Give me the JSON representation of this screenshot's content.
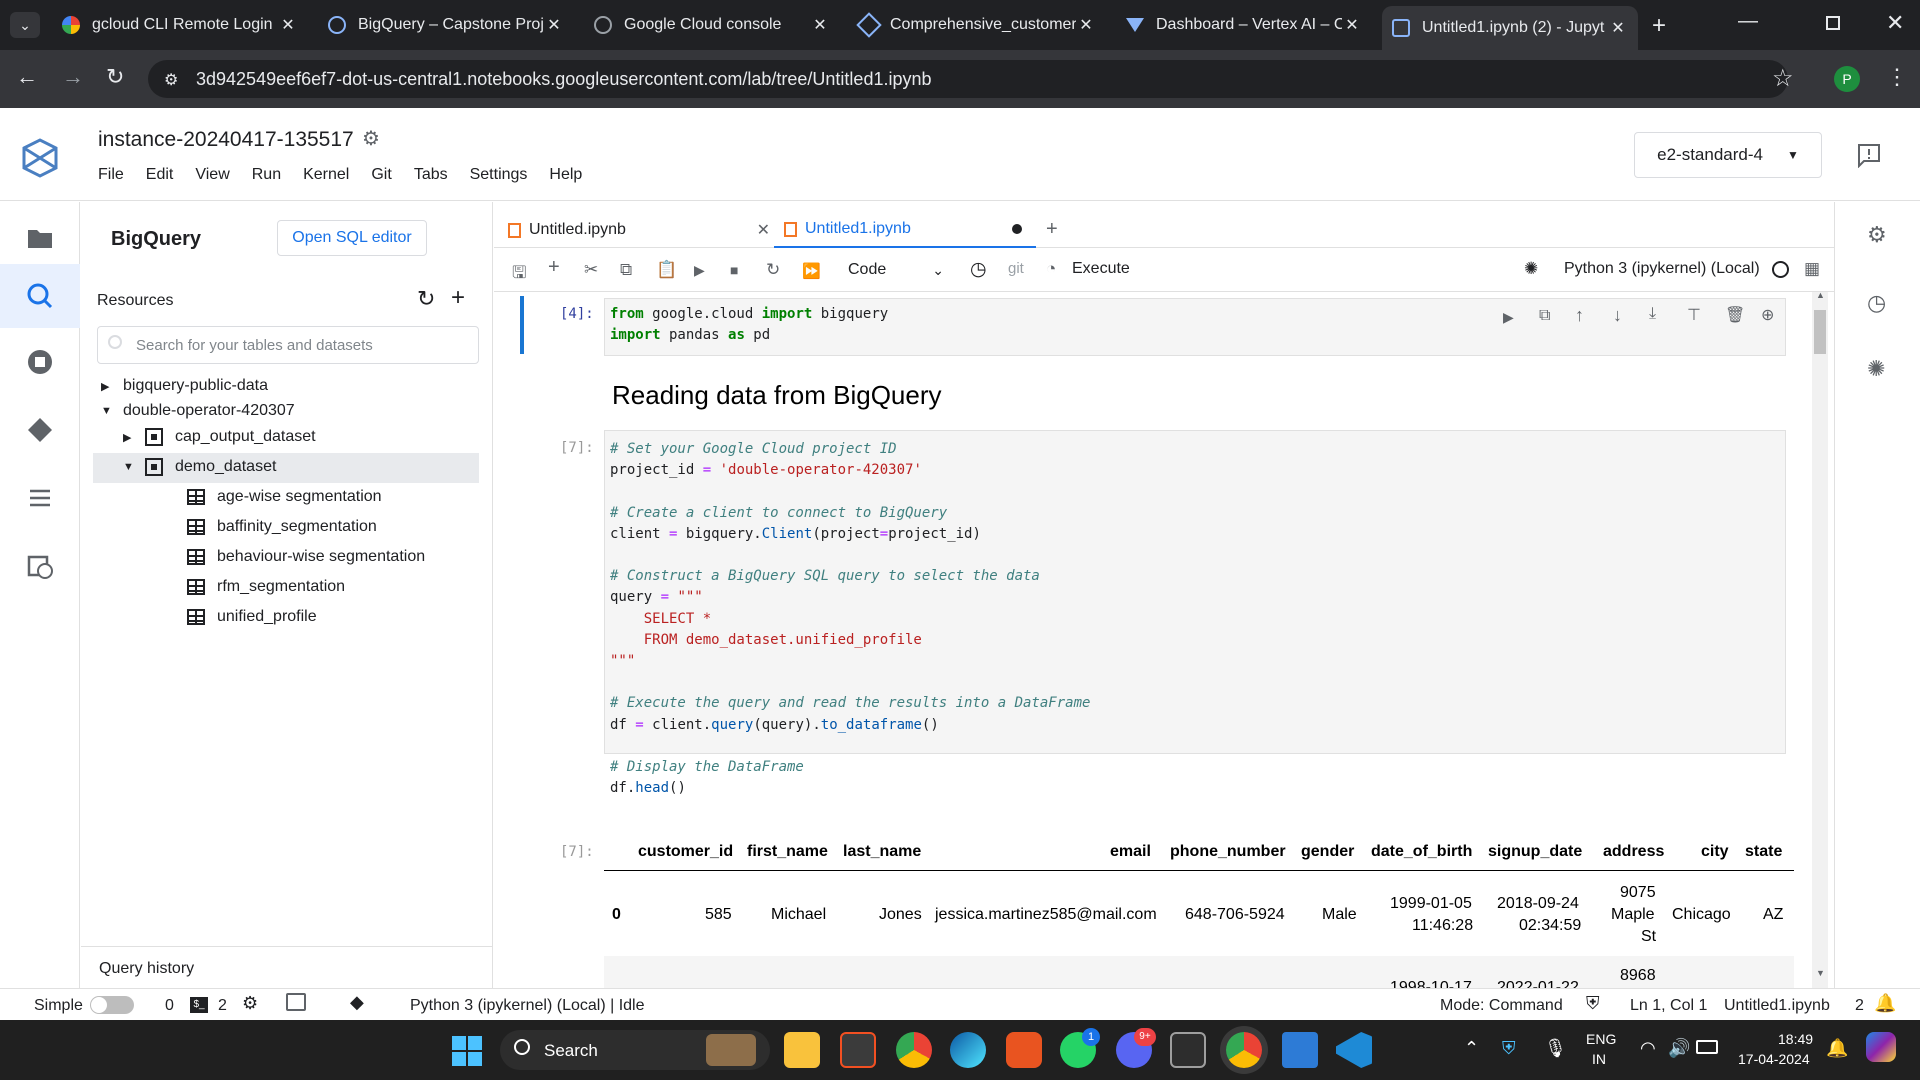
{
  "browser": {
    "tabs": [
      {
        "title": "gcloud CLI Remote Login"
      },
      {
        "title": "BigQuery – Capstone Proj"
      },
      {
        "title": "Google Cloud console"
      },
      {
        "title": "Comprehensive_customer"
      },
      {
        "title": "Dashboard – Vertex AI – C"
      },
      {
        "title": "Untitled1.ipynb (2) - Jupyt"
      }
    ],
    "url": "3d942549eef6ef7-dot-us-central1.notebooks.googleusercontent.com/lab/tree/Untitled1.ipynb",
    "profile_initial": "P"
  },
  "jupyter": {
    "instance_name": "instance-20240417-135517",
    "menus": [
      "File",
      "Edit",
      "View",
      "Run",
      "Kernel",
      "Git",
      "Tabs",
      "Settings",
      "Help"
    ],
    "machine_type": "e2-standard-4"
  },
  "sidepanel": {
    "title": "BigQuery",
    "open_sql": "Open SQL editor",
    "resources_label": "Resources",
    "search_placeholder": "Search for your tables and datasets",
    "projects": [
      "bigquery-public-data",
      "double-operator-420307"
    ],
    "datasets": [
      "cap_output_dataset",
      "demo_dataset"
    ],
    "tables": [
      "age-wise segmentation",
      "baffinity_segmentation",
      "behaviour-wise segmentation",
      "rfm_segmentation",
      "unified_profile"
    ],
    "query_history": "Query history"
  },
  "notebook": {
    "tabs": [
      {
        "title": "Untitled.ipynb"
      },
      {
        "title": "Untitled1.ipynb"
      }
    ],
    "cell_type": "Code",
    "git_label": "git",
    "execute_label": "Execute",
    "kernel": "Python 3 (ipykernel) (Local)",
    "cells": {
      "c1_prompt": "[4]:",
      "heading": "Reading data from BigQuery",
      "c2_prompt": "[7]:",
      "out_prompt": "[7]:"
    }
  },
  "dataframe": {
    "columns": [
      "customer_id",
      "first_name",
      "last_name",
      "email",
      "phone_number",
      "gender",
      "date_of_birth",
      "signup_date",
      "address",
      "city",
      "state"
    ],
    "row0": {
      "index": "0",
      "customer_id": "585",
      "first_name": "Michael",
      "last_name": "Jones",
      "email": "jessica.martinez585@mail.com",
      "phone_number": "648-706-5924",
      "gender": "Male",
      "dob_date": "1999-01-05",
      "dob_time": "11:46:28",
      "signup_date": "2018-09-24",
      "signup_time": "02:34:59",
      "address_1": "9075",
      "address_2": "Maple",
      "address_3": "St",
      "city": "Chicago",
      "state": "AZ"
    },
    "row1_partial": {
      "dob": "1998-10-17",
      "signup": "2022-01-22",
      "address": "8968"
    }
  },
  "statusbar": {
    "simple": "Simple",
    "zero": "0",
    "two": "2",
    "kernel_status": "Python 3 (ipykernel) (Local) | Idle",
    "mode": "Mode: Command",
    "position": "Ln 1, Col 1",
    "filename": "Untitled1.ipynb",
    "notif_count": "2"
  },
  "taskbar": {
    "search": "Search",
    "lang1": "ENG",
    "lang2": "IN",
    "time": "18:49",
    "date": "17-04-2024",
    "whatsapp_badge": "1",
    "discord_badge": "9+"
  }
}
